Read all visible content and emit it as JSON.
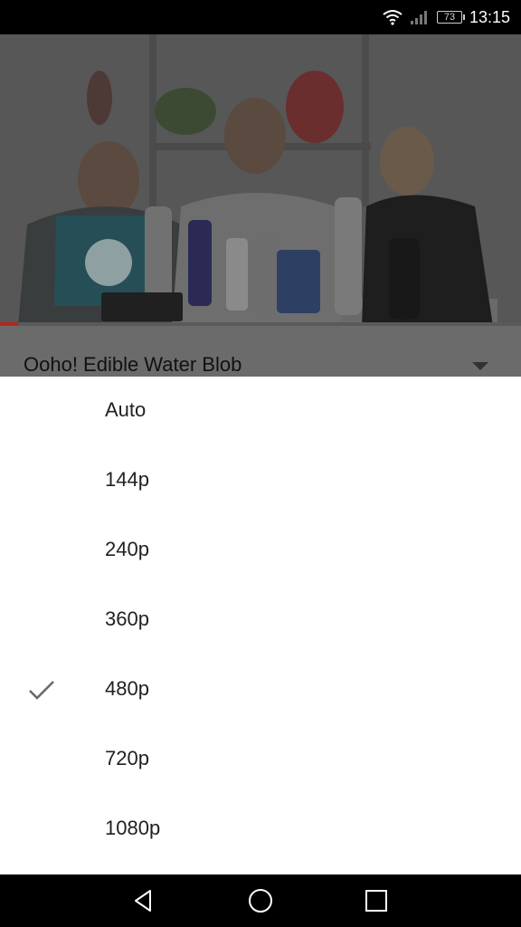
{
  "status_bar": {
    "battery": "73",
    "time": "13:15",
    "icons": [
      "wifi-icon",
      "signal-icon",
      "battery-icon"
    ]
  },
  "video": {
    "title": "Ooho! Edible Water Blob",
    "progress": 0.035
  },
  "quality_menu": {
    "options": [
      {
        "label": "Auto",
        "selected": false
      },
      {
        "label": "144p",
        "selected": false
      },
      {
        "label": "240p",
        "selected": false
      },
      {
        "label": "360p",
        "selected": false
      },
      {
        "label": "480p",
        "selected": true
      },
      {
        "label": "720p",
        "selected": false
      },
      {
        "label": "1080p",
        "selected": false
      }
    ]
  },
  "nav_bar": {
    "icons": [
      "back-icon",
      "home-icon",
      "recents-icon"
    ]
  },
  "colors": {
    "progress": "#b3261e",
    "menu_bg": "#ffffff",
    "check": "#6b6b6b"
  }
}
